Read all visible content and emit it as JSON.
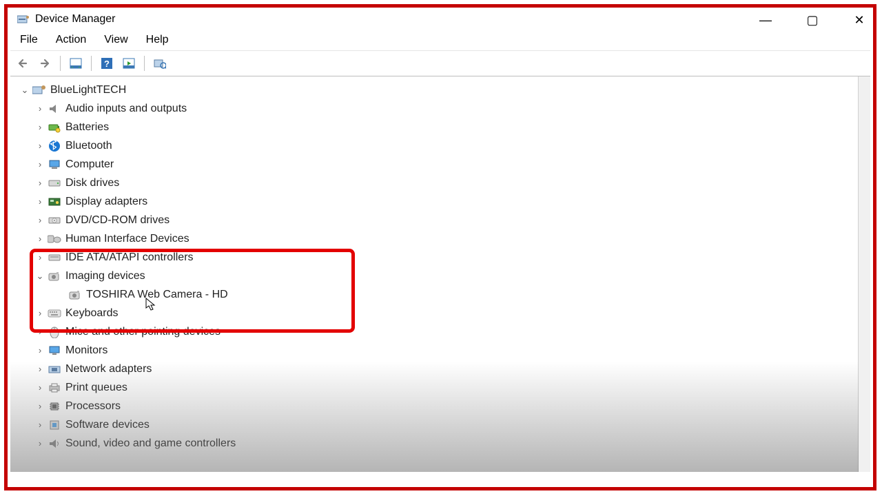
{
  "window": {
    "title": "Device Manager",
    "controls": {
      "minimize": "—",
      "maximize": "▢",
      "close": "✕"
    }
  },
  "menu": {
    "file": "File",
    "action": "Action",
    "view": "View",
    "help": "Help"
  },
  "toolbar_icons": {
    "back": "back-arrow",
    "fwd": "forward-arrow",
    "show": "show-hidden",
    "help": "help",
    "refresh": "refresh",
    "scan": "scan-hardware"
  },
  "tree": {
    "root": {
      "label": "BlueLightTECH",
      "expanded": true
    },
    "cats": [
      {
        "key": "audio",
        "label": "Audio inputs and outputs",
        "expanded": false
      },
      {
        "key": "batt",
        "label": "Batteries",
        "expanded": false
      },
      {
        "key": "bt",
        "label": "Bluetooth",
        "expanded": false
      },
      {
        "key": "comp",
        "label": "Computer",
        "expanded": false
      },
      {
        "key": "disk",
        "label": "Disk drives",
        "expanded": false
      },
      {
        "key": "disp",
        "label": "Display adapters",
        "expanded": false
      },
      {
        "key": "dvd",
        "label": "DVD/CD-ROM drives",
        "expanded": false
      },
      {
        "key": "hid",
        "label": "Human Interface Devices",
        "expanded": false
      },
      {
        "key": "ide",
        "label": "IDE ATA/ATAPI controllers",
        "expanded": false
      },
      {
        "key": "img",
        "label": "Imaging devices",
        "expanded": true,
        "children": [
          {
            "key": "cam",
            "label": "TOSHIRA Web Camera - HD"
          }
        ]
      },
      {
        "key": "kbd",
        "label": "Keyboards",
        "expanded": false
      },
      {
        "key": "mouse",
        "label": "Mice and other pointing devices",
        "expanded": false
      },
      {
        "key": "mon",
        "label": "Monitors",
        "expanded": false
      },
      {
        "key": "net",
        "label": "Network adapters",
        "expanded": false
      },
      {
        "key": "print",
        "label": "Print queues",
        "expanded": false
      },
      {
        "key": "cpu",
        "label": "Processors",
        "expanded": false
      },
      {
        "key": "soft",
        "label": "Software devices",
        "expanded": false
      },
      {
        "key": "sound",
        "label": "Sound, video and game controllers",
        "expanded": false
      }
    ]
  },
  "colors": {
    "red": "#c40000",
    "highlight_red": "#e30000",
    "link_blue": "#0a58ca"
  }
}
